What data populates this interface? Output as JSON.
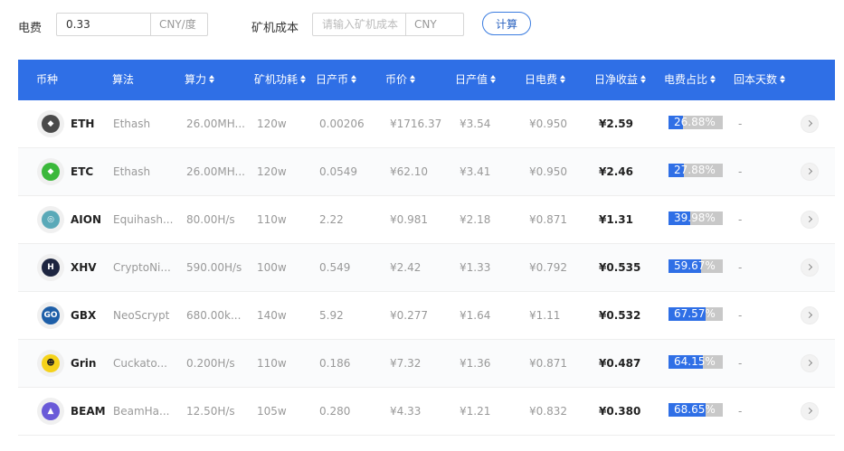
{
  "controls": {
    "electricity_label": "电费",
    "electricity_value": "0.33",
    "electricity_unit": "CNY/度",
    "cost_label": "矿机成本",
    "cost_placeholder": "请输入矿机成本",
    "cost_unit": "CNY",
    "calc_button": "计算"
  },
  "columns": [
    "币种",
    "算法",
    "算力",
    "矿机功耗",
    "日产币",
    "币价",
    "日产值",
    "日电费",
    "日净收益",
    "电费占比",
    "回本天数"
  ],
  "rows": [
    {
      "symbol": "ETH",
      "algo": "Ethash",
      "hashrate": "26.00MH...",
      "power": "120w",
      "daily_coin": "0.00206",
      "price": "¥1716.37",
      "daily_value": "¥3.54",
      "daily_elec": "¥0.950",
      "net": "¥2.59",
      "ratio_text": "26.88%",
      "ratio": 26.88,
      "payback": "-",
      "icon": "ethereum-icon",
      "icon_color": "#4a4a4a",
      "glyph": "◆"
    },
    {
      "symbol": "ETC",
      "algo": "Ethash",
      "hashrate": "26.00MH...",
      "power": "120w",
      "daily_coin": "0.0549",
      "price": "¥62.10",
      "daily_value": "¥3.41",
      "daily_elec": "¥0.950",
      "net": "¥2.46",
      "ratio_text": "27.88%",
      "ratio": 27.88,
      "payback": "-",
      "icon": "ethereum-classic-icon",
      "icon_color": "#3ab83a",
      "glyph": "◆"
    },
    {
      "symbol": "AION",
      "algo": "Equihash...",
      "hashrate": "80.00H/s",
      "power": "110w",
      "daily_coin": "2.22",
      "price": "¥0.981",
      "daily_value": "¥2.18",
      "daily_elec": "¥0.871",
      "net": "¥1.31",
      "ratio_text": "39.98%",
      "ratio": 39.98,
      "payback": "-",
      "icon": "aion-icon",
      "icon_color": "#5aa9b8",
      "glyph": "◎"
    },
    {
      "symbol": "XHV",
      "algo": "CryptoNi...",
      "hashrate": "590.00H/s",
      "power": "100w",
      "daily_coin": "0.549",
      "price": "¥2.42",
      "daily_value": "¥1.33",
      "daily_elec": "¥0.792",
      "net": "¥0.535",
      "ratio_text": "59.67%",
      "ratio": 59.67,
      "payback": "-",
      "icon": "haven-icon",
      "icon_color": "#1d2540",
      "glyph": "H"
    },
    {
      "symbol": "GBX",
      "algo": "NeoScrypt",
      "hashrate": "680.00k...",
      "power": "140w",
      "daily_coin": "5.92",
      "price": "¥0.277",
      "daily_value": "¥1.64",
      "daily_elec": "¥1.11",
      "net": "¥0.532",
      "ratio_text": "67.57%",
      "ratio": 67.57,
      "payback": "-",
      "icon": "gobyte-icon",
      "icon_color": "#1e5fa8",
      "glyph": "GO"
    },
    {
      "symbol": "Grin",
      "algo": "Cuckato...",
      "hashrate": "0.200H/s",
      "power": "110w",
      "daily_coin": "0.186",
      "price": "¥7.32",
      "daily_value": "¥1.36",
      "daily_elec": "¥0.871",
      "net": "¥0.487",
      "ratio_text": "64.15%",
      "ratio": 64.15,
      "payback": "-",
      "icon": "grin-icon",
      "icon_color": "#f5d21a",
      "glyph": "☻"
    },
    {
      "symbol": "BEAM",
      "algo": "BeamHa...",
      "hashrate": "12.50H/s",
      "power": "105w",
      "daily_coin": "0.280",
      "price": "¥4.33",
      "daily_value": "¥1.21",
      "daily_elec": "¥0.832",
      "net": "¥0.380",
      "ratio_text": "68.65%",
      "ratio": 68.65,
      "payback": "-",
      "icon": "beam-icon",
      "icon_color": "#6a5ad8",
      "glyph": "▲"
    }
  ]
}
